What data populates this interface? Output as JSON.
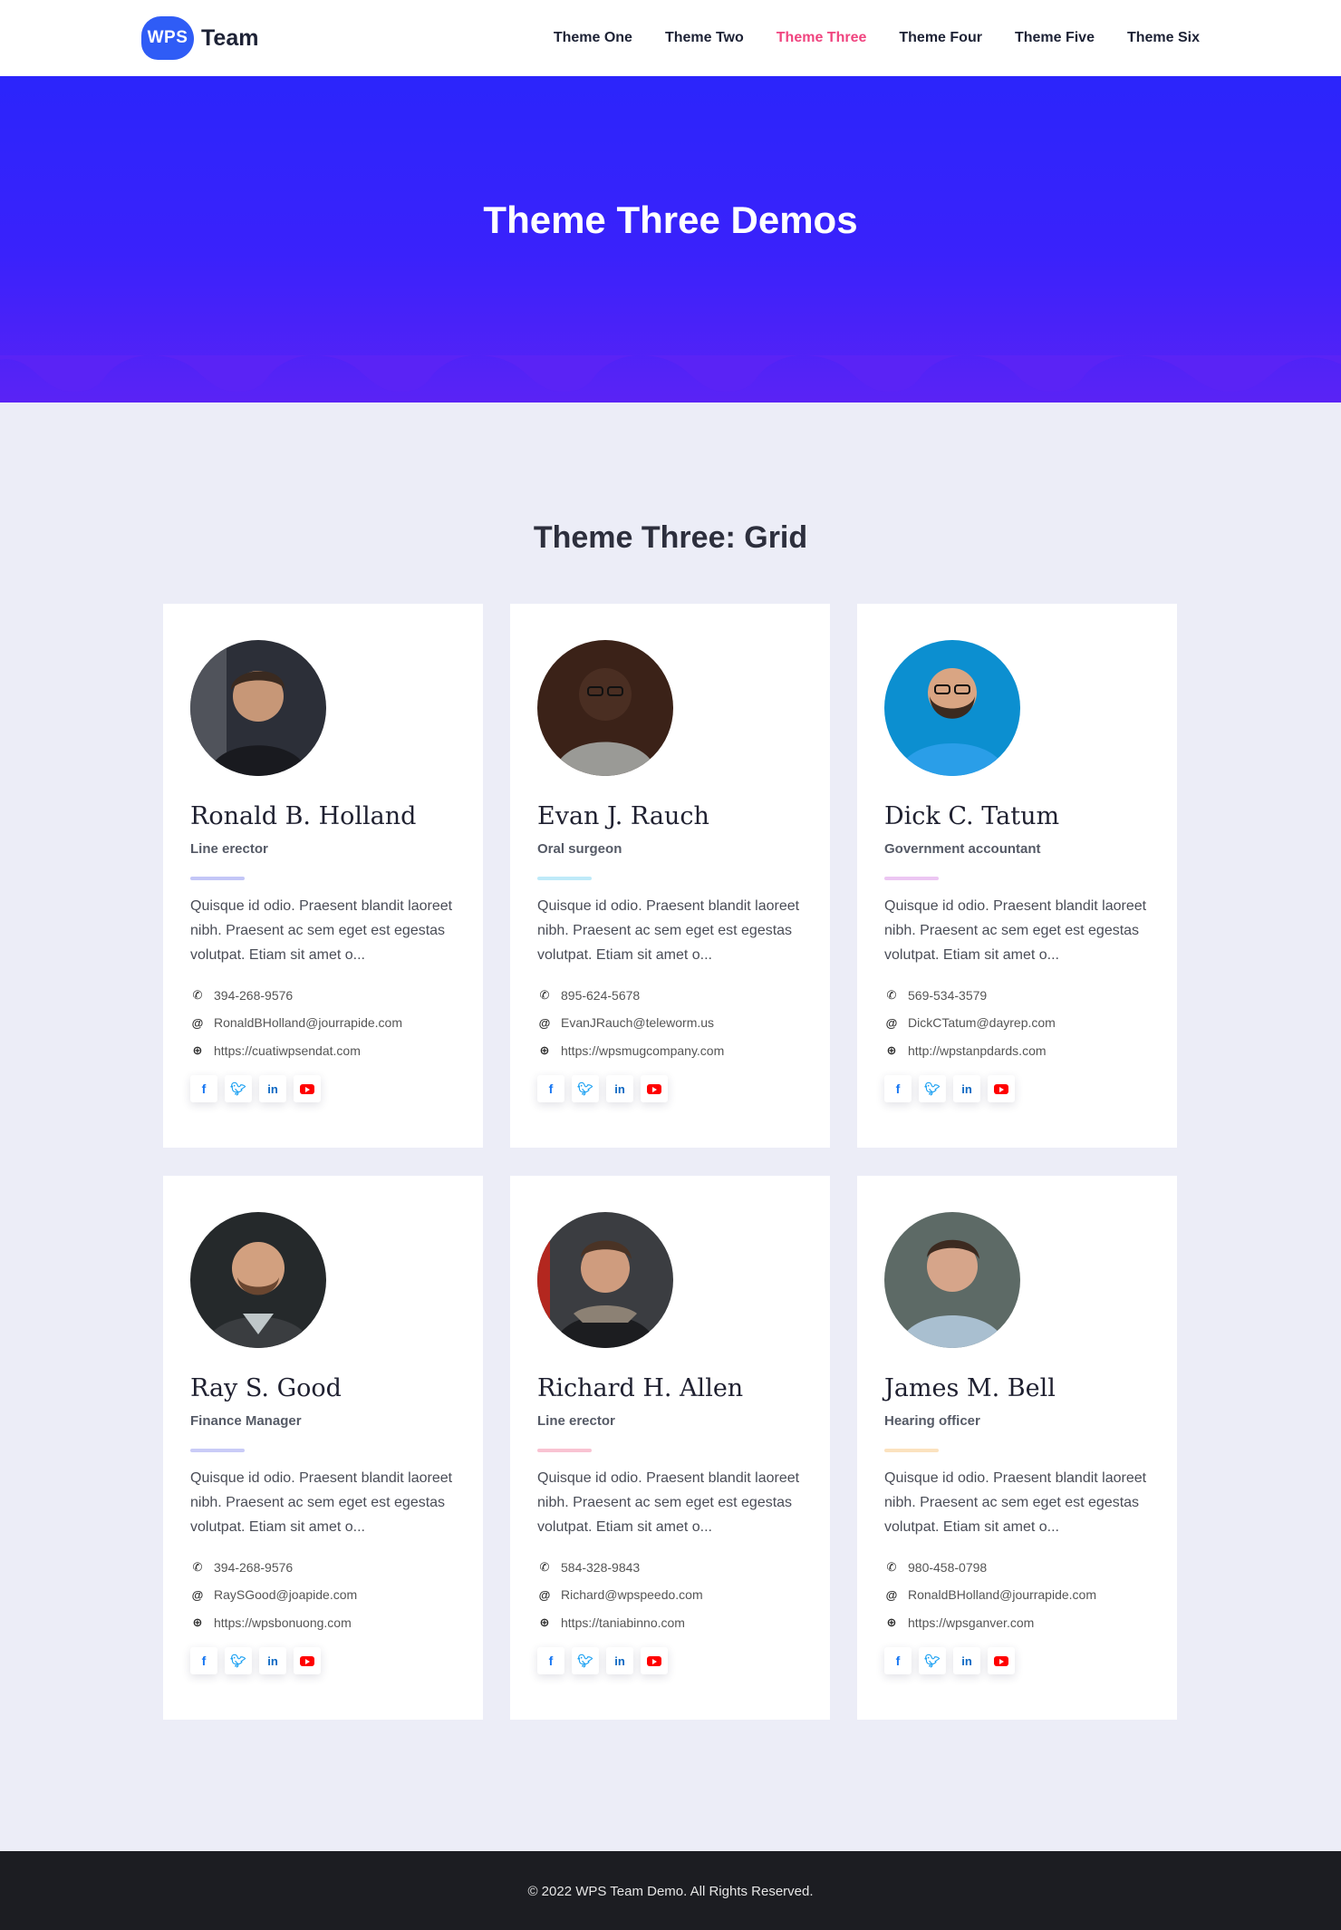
{
  "header": {
    "logo_badge": "WPS",
    "logo_text": "Team",
    "nav": [
      {
        "label": "Theme One"
      },
      {
        "label": "Theme Two"
      },
      {
        "label": "Theme Three"
      },
      {
        "label": "Theme Four"
      },
      {
        "label": "Theme Five"
      },
      {
        "label": "Theme Six"
      }
    ],
    "active_nav": "Theme Three"
  },
  "hero": {
    "title": "Theme Three Demos"
  },
  "section": {
    "title": "Theme Three: Grid"
  },
  "cards": [
    {
      "name": "Ronald B. Holland",
      "role": "Line erector",
      "accent": "#c3c6f7",
      "desc": "Quisque id odio. Praesent blandit laoreet nibh. Praesent ac sem eget est egestas volutpat. Etiam sit amet o...",
      "phone": "394-268-9576",
      "email": "RonaldBHolland@jourrapide.com",
      "website": "https://cuatiwpsendat.com"
    },
    {
      "name": "Evan J. Rauch",
      "role": "Oral surgeon",
      "accent": "#bfeaf9",
      "desc": "Quisque id odio. Praesent blandit laoreet nibh. Praesent ac sem eget est egestas volutpat. Etiam sit amet o...",
      "phone": "895-624-5678",
      "email": "EvanJRauch@teleworm.us",
      "website": "https://wpsmugcompany.com"
    },
    {
      "name": "Dick C. Tatum",
      "role": "Government accountant",
      "accent": "#ecc6f2",
      "desc": "Quisque id odio. Praesent blandit laoreet nibh. Praesent ac sem eget est egestas volutpat. Etiam sit amet o...",
      "phone": "569-534-3579",
      "email": "DickCTatum@dayrep.com",
      "website": "http://wpstanpdards.com"
    },
    {
      "name": "Ray S. Good",
      "role": "Finance Manager",
      "accent": "#c9cbf7",
      "desc": "Quisque id odio. Praesent blandit laoreet nibh. Praesent ac sem eget est egestas volutpat. Etiam sit amet o...",
      "phone": "394-268-9576",
      "email": "RaySGood@joapide.com",
      "website": "https://wpsbonuong.com"
    },
    {
      "name": "Richard H. Allen",
      "role": "Line erector",
      "accent": "#f9c3d2",
      "desc": "Quisque id odio. Praesent blandit laoreet nibh. Praesent ac sem eget est egestas volutpat. Etiam sit amet o...",
      "phone": "584-328-9843",
      "email": "Richard@wpspeedo.com",
      "website": "https://taniabinno.com"
    },
    {
      "name": "James M. Bell",
      "role": "Hearing officer",
      "accent": "#fbe2bf",
      "desc": "Quisque id odio. Praesent blandit laoreet nibh. Praesent ac sem eget est egestas volutpat. Etiam sit amet o...",
      "phone": "980-458-0798",
      "email": "RonaldBHolland@jourrapide.com",
      "website": "https://wpsganver.com"
    }
  ],
  "footer": {
    "text": "© 2022 WPS Team Demo. All Rights Reserved."
  },
  "colors": {
    "hero_top": "#2b25fb",
    "hero_bottom": "#5a23f5",
    "active_nav": "#f0447f",
    "page_bg": "#ecedf7",
    "footer_bg": "#1c1d22"
  }
}
